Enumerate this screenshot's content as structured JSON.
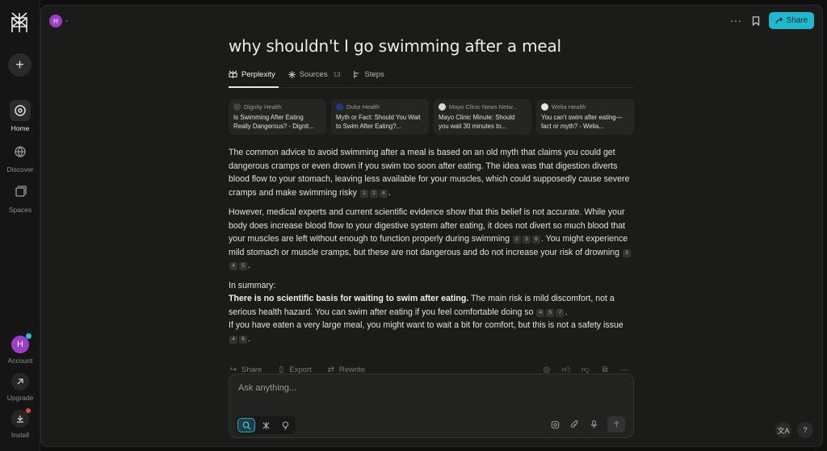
{
  "sidebar": {
    "new_label": "+",
    "items": [
      {
        "label": "Home",
        "icon": "home-search-icon",
        "active": true
      },
      {
        "label": "Discover",
        "icon": "globe-icon",
        "active": false
      },
      {
        "label": "Spaces",
        "icon": "spaces-icon",
        "active": false
      }
    ],
    "account": {
      "initial": "H",
      "label": "Account"
    },
    "upgrade_label": "Upgrade",
    "install_label": "Install"
  },
  "topbar": {
    "avatar_initial": "H",
    "more_label": "···",
    "share_label": "Share"
  },
  "thread": {
    "title": "why shouldn't I go swimming after a meal",
    "tabs": [
      {
        "label": "Perplexity",
        "icon": "perplexity-icon"
      },
      {
        "label": "Sources",
        "icon": "sources-icon",
        "count": "13"
      },
      {
        "label": "Steps",
        "icon": "steps-icon"
      }
    ]
  },
  "sources": [
    {
      "site": "Dignity Health",
      "title": "Is Swimming After Eating Really Dangerous? - Dignit..."
    },
    {
      "site": "Duke Health",
      "title": "Myth or Fact: Should You Wait to Swim After Eating?..."
    },
    {
      "site": "Mayo Clinic News Netw...",
      "title": "Mayo Clinic Minute: Should you wait 30 minutes to..."
    },
    {
      "site": "Welia Health",
      "title": "You can't swim after eating—fact or myth? - Welia..."
    }
  ],
  "answer": {
    "p1": "The common advice to avoid swimming after a meal is based on an old myth that claims you could get dangerous cramps or even drown if you swim too soon after eating. The idea was that digestion diverts blood flow to your stomach, leaving less available for your muscles, which could supposedly cause severe cramps and make swimming risky",
    "p1_cites": [
      "1",
      "2",
      "4"
    ],
    "p2a": "However, medical experts and current scientific evidence show that this belief is not accurate. While your body does increase blood flow to your digestive system after eating, it does not divert so much blood that your muscles are left without enough to function properly during swimming",
    "p2a_cites": [
      "2",
      "3",
      "6"
    ],
    "p2b": ". You might experience mild stomach or muscle cramps, but these are not dangerous and do not increase your risk of drowning",
    "p2b_cites": [
      "3",
      "4",
      "5"
    ],
    "summary_intro": "In summary:",
    "summary_bold": "There is no scientific basis for waiting to swim after eating.",
    "summary_rest": " The main risk is mild discomfort, not a serious health hazard. You can swim after eating if you feel comfortable doing so",
    "summary_cites": [
      "4",
      "5",
      "7"
    ],
    "summary_last": "If you have eaten a very large meal, you might want to wait a bit for comfort, but this is not a safety issue",
    "summary_last_cites": [
      "4",
      "6"
    ]
  },
  "actions": {
    "share": "Share",
    "export": "Export",
    "rewrite": "Rewrite"
  },
  "ask": {
    "placeholder": "Ask anything..."
  },
  "corner": {
    "translate": "文A",
    "help": "?"
  },
  "colors": {
    "accent": "#20b8cd",
    "avatar": "#9b3fc7"
  }
}
